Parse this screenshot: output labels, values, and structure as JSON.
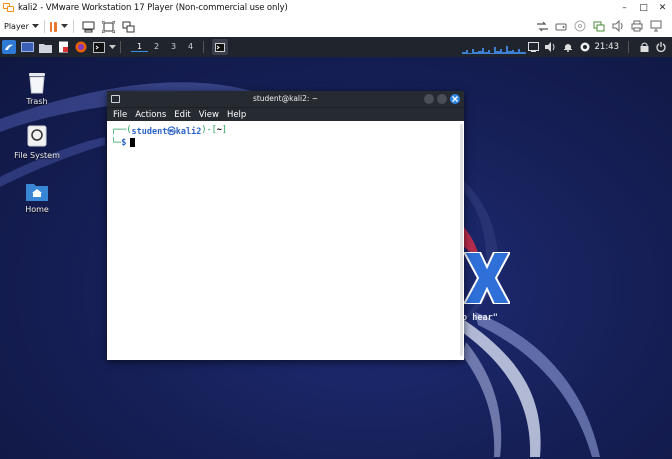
{
  "vmware": {
    "title": "kali2 - VMware Workstation 17 Player (Non-commercial use only)",
    "player_menu_label": "Player",
    "window_controls": {
      "minimize": "–",
      "maximize": "□",
      "close": "✕"
    }
  },
  "kali_panel": {
    "workspaces": [
      "1",
      "2",
      "3",
      "4"
    ],
    "active_workspace": "1",
    "clock": "21:43"
  },
  "desktop": {
    "icons": [
      {
        "label": "Trash"
      },
      {
        "label": "File System"
      },
      {
        "label": "Home"
      }
    ],
    "logo_tagline_fragment": "o hear\""
  },
  "terminal": {
    "title": "student@kali2: ~",
    "menu": [
      "File",
      "Actions",
      "Edit",
      "View",
      "Help"
    ],
    "prompt": {
      "corner_top": "┌──(",
      "user_host": "student㉿kali2",
      "bracket_mid": ")-[",
      "cwd": "~",
      "bracket_end": "]",
      "corner_bottom": "└─",
      "symbol": "$"
    }
  },
  "colors": {
    "terminal_green": "#1f9e57",
    "terminal_blue": "#2b63c6",
    "panel_bg": "#20242c",
    "desktop_bg": "#17215a",
    "vmware_orange": "#e8772e"
  }
}
